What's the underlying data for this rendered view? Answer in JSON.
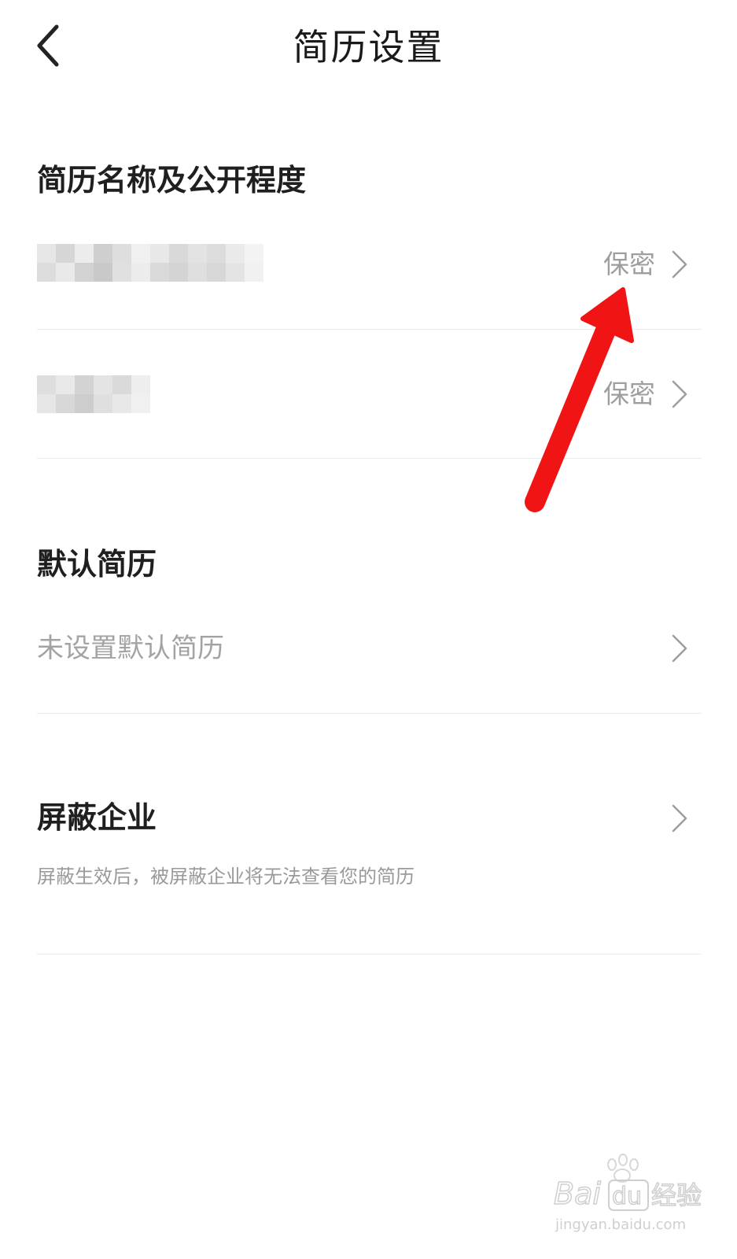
{
  "header": {
    "title": "简历设置"
  },
  "sections": {
    "visibility": {
      "title": "简历名称及公开程度",
      "items": [
        {
          "value": "保密"
        },
        {
          "value": "保密"
        }
      ]
    },
    "default_resume": {
      "title": "默认简历",
      "item_label": "未设置默认简历"
    },
    "block_companies": {
      "title": "屏蔽企业",
      "hint": "屏蔽生效后，被屏蔽企业将无法查看您的简历"
    }
  },
  "watermark": {
    "brand": "Bai",
    "brand_du": "du",
    "product": "经验",
    "url": "jingyan.baidu.com"
  },
  "colors": {
    "annotation_arrow": "#f01414",
    "muted_text": "#9e9e9e",
    "divider": "#ebebeb"
  }
}
